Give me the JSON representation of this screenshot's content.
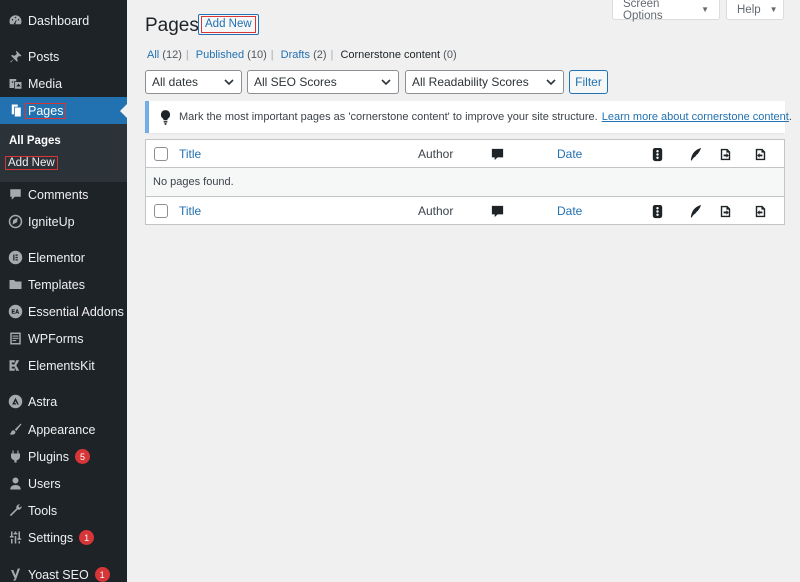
{
  "sidebar": {
    "items": [
      {
        "label": "Dashboard",
        "icon": "dashboard-icon",
        "badge": ""
      },
      {
        "label": "Posts",
        "icon": "pin-icon",
        "badge": ""
      },
      {
        "label": "Media",
        "icon": "media-icon",
        "badge": ""
      },
      {
        "label": "Pages",
        "icon": "page-icon",
        "badge": ""
      },
      {
        "label": "Comments",
        "icon": "comment-icon",
        "badge": ""
      },
      {
        "label": "IgniteUp",
        "icon": "igniteup-icon",
        "badge": ""
      },
      {
        "label": "Elementor",
        "icon": "elementor-icon",
        "badge": ""
      },
      {
        "label": "Templates",
        "icon": "folder-icon",
        "badge": ""
      },
      {
        "label": "Essential Addons",
        "icon": "ea-icon",
        "badge": ""
      },
      {
        "label": "WPForms",
        "icon": "form-icon",
        "badge": ""
      },
      {
        "label": "ElementsKit",
        "icon": "elementskit-icon",
        "badge": ""
      },
      {
        "label": "Astra",
        "icon": "astra-icon",
        "badge": ""
      },
      {
        "label": "Appearance",
        "icon": "brush-icon",
        "badge": ""
      },
      {
        "label": "Plugins",
        "icon": "plugin-icon",
        "badge": "5"
      },
      {
        "label": "Users",
        "icon": "user-icon",
        "badge": ""
      },
      {
        "label": "Tools",
        "icon": "wrench-icon",
        "badge": ""
      },
      {
        "label": "Settings",
        "icon": "settings-icon",
        "badge": "1"
      },
      {
        "label": "Yoast SEO",
        "icon": "yoast-icon",
        "badge": "1"
      }
    ],
    "submenu": {
      "all_pages": "All Pages",
      "add_new": "Add New"
    }
  },
  "top": {
    "screen_options": "Screen Options",
    "help": "Help"
  },
  "header": {
    "title": "Pages",
    "add_new": "Add New"
  },
  "views": [
    {
      "label": "All",
      "count": "(12)"
    },
    {
      "label": "Published",
      "count": "(10)"
    },
    {
      "label": "Drafts",
      "count": "(2)"
    },
    {
      "label": "Cornerstone content",
      "count": "(0)"
    }
  ],
  "filters": {
    "dates": "All dates",
    "seo": "All SEO Scores",
    "readability": "All Readability Scores",
    "button": "Filter"
  },
  "notice": {
    "text": "Mark the most important pages as 'cornerstone content' to improve your site structure.",
    "link": "Learn more about cornerstone content",
    "end": "."
  },
  "table": {
    "columns": {
      "title": "Title",
      "author": "Author",
      "date": "Date"
    },
    "empty_message": "No pages found."
  },
  "colors": {
    "sidebar_bg": "#1d2327",
    "accent": "#2271b1",
    "highlight": "#d63638",
    "background": "#f0f0f1"
  }
}
